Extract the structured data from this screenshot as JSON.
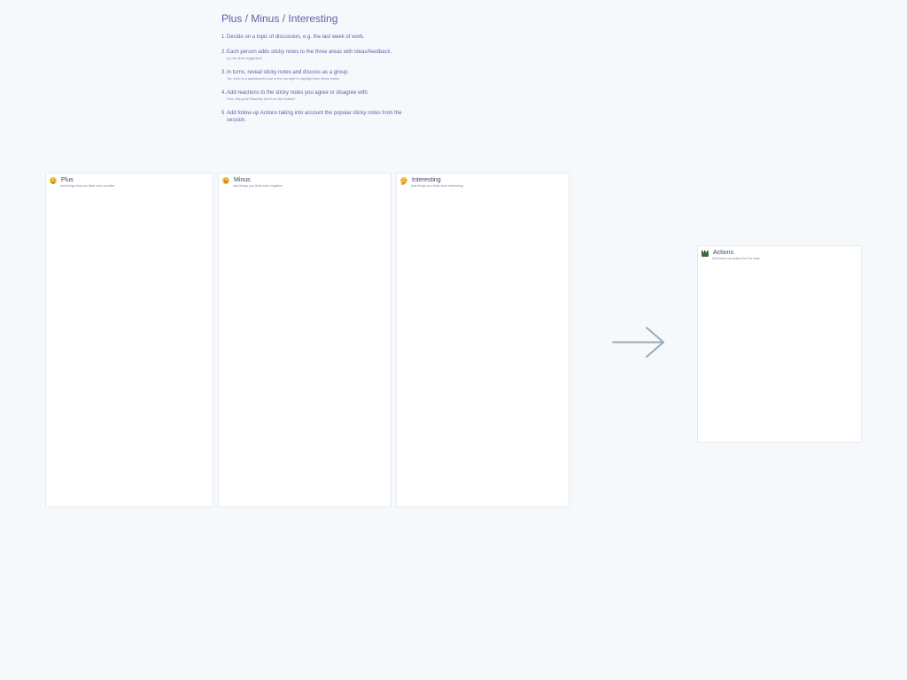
{
  "instructions": {
    "title": "Plus / Minus / Interesting",
    "steps": [
      {
        "num": "1.",
        "text": "Decide on a topic of discussion, e.g. the last week of work.",
        "hint": ""
      },
      {
        "num": "2.",
        "text": "Each person adds sticky notes to the three areas with ideas/feedback.",
        "hint": "(x) min timer suggested"
      },
      {
        "num": "3.",
        "text": "In turns, reveal sticky notes and discuss as a group.",
        "hint": "Tip: click on a participant's icon in the top right to highlight their sticky notes!"
      },
      {
        "num": "4.",
        "text": "Add reactions to the sticky notes you agree or disagree with.",
        "hint": "Hint: Using the Reaction tool from the toolbar!"
      },
      {
        "num": "5.",
        "text": "Add follow-up Actions taking into account the popular sticky notes from the session.",
        "hint": ""
      }
    ]
  },
  "panels": {
    "plus": {
      "title": "Plus",
      "subtitle": "Add things that you think were positive",
      "icon": "grinning-face-icon"
    },
    "minus": {
      "title": "Minus",
      "subtitle": "Add things you think were negative",
      "icon": "worried-face-icon"
    },
    "interesting": {
      "title": "Interesting",
      "subtitle": "Add things you think were interesting",
      "icon": "thinking-face-icon"
    },
    "actions": {
      "title": "Actions",
      "subtitle": "Add follow-up actions for the team",
      "icon": "clapper-board-icon"
    }
  },
  "colors": {
    "background": "#f6f9fc",
    "instruction_text": "#5b63a8",
    "panel_border": "#e6eaef",
    "arrow": "#9aaab5"
  }
}
